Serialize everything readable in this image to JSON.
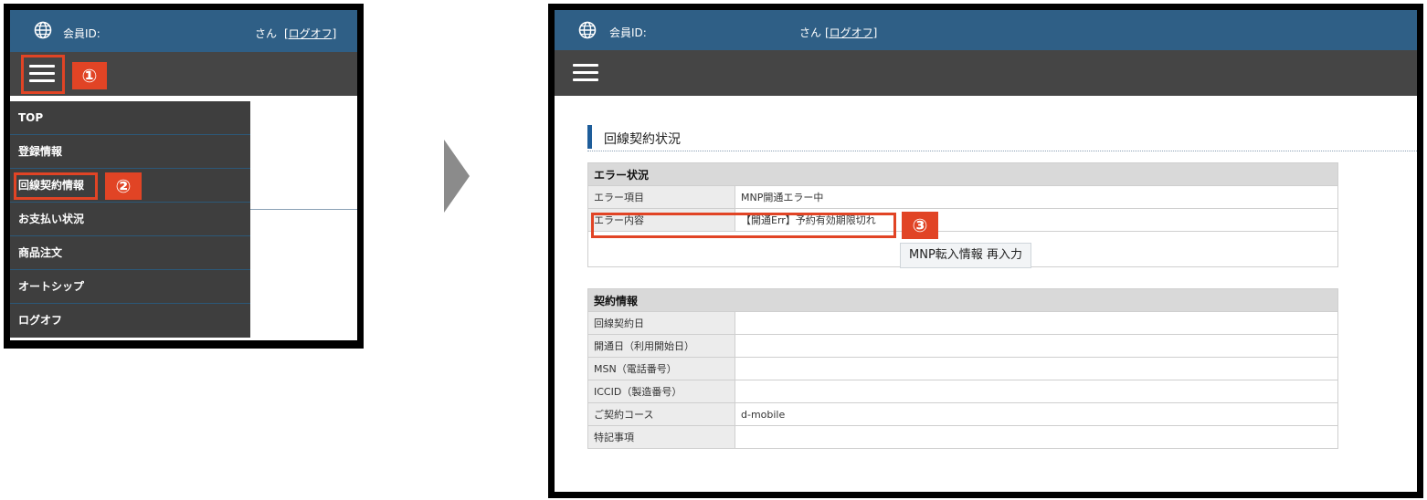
{
  "header": {
    "member_label": "会員ID:",
    "san": "さん",
    "logoff_link": "[ログオフ]"
  },
  "markers": {
    "one": "①",
    "two": "②",
    "three": "③"
  },
  "menu": {
    "items": [
      {
        "label": "TOP"
      },
      {
        "label": "登録情報"
      },
      {
        "label": "回線契約情報"
      },
      {
        "label": "お支払い状況"
      },
      {
        "label": "商品注文"
      },
      {
        "label": "オートシップ"
      },
      {
        "label": "ログオフ"
      }
    ]
  },
  "page": {
    "title": "回線契約状況",
    "error": {
      "heading": "エラー状況",
      "rows": [
        {
          "label": "エラー項目",
          "value": "MNP開通エラー中"
        },
        {
          "label": "エラー内容",
          "value": "【開通Err】予約有効期限切れ"
        }
      ],
      "button": "MNP転入情報 再入力"
    },
    "contract": {
      "heading": "契約情報",
      "rows": [
        {
          "label": "回線契約日",
          "value": ""
        },
        {
          "label": "開通日（利用開始日）",
          "value": ""
        },
        {
          "label": "MSN（電話番号）",
          "value": ""
        },
        {
          "label": "ICCID（製造番号）",
          "value": ""
        },
        {
          "label": "ご契約コース",
          "value": "d-mobile"
        },
        {
          "label": "特記事項",
          "value": ""
        }
      ]
    }
  },
  "colors": {
    "header_blue": "#2f5f86",
    "nav_gray": "#454545",
    "highlight_red": "#e14425"
  }
}
